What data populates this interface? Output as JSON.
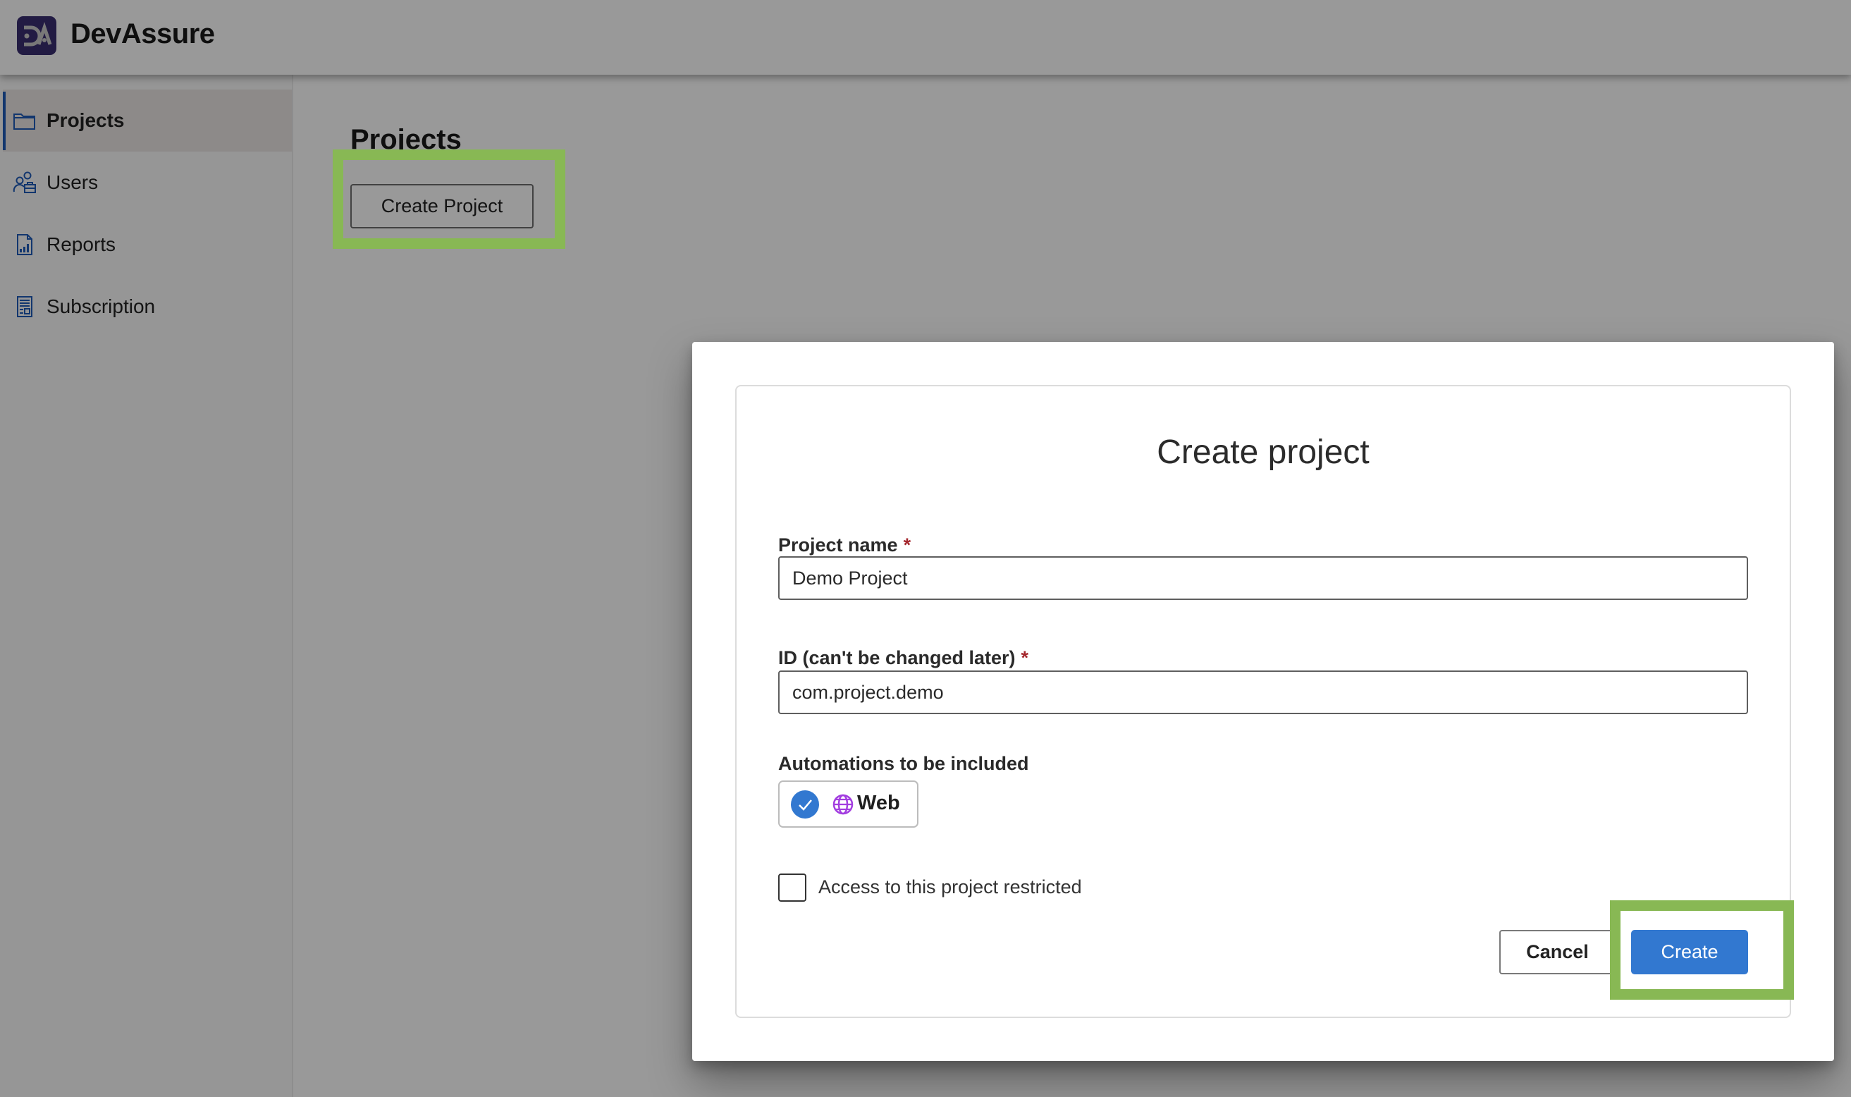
{
  "app": {
    "brand": "DevAssure",
    "logo_text": "DA",
    "brand_color": "#3a2d70",
    "accent_color": "#3278d0",
    "highlight_color": "#88b854"
  },
  "sidebar": {
    "items": [
      {
        "label": "Projects",
        "icon": "folder-icon",
        "active": true
      },
      {
        "label": "Users",
        "icon": "users-icon",
        "active": false
      },
      {
        "label": "Reports",
        "icon": "report-chart-icon",
        "active": false
      },
      {
        "label": "Subscription",
        "icon": "subscription-document-icon",
        "active": false
      }
    ]
  },
  "main": {
    "title": "Projects",
    "create_project_label": "Create Project"
  },
  "modal": {
    "title": "Create project",
    "fields": {
      "project_name": {
        "label": "Project name",
        "required_mark": "*",
        "value": "Demo Project"
      },
      "project_id": {
        "label": "ID (can't be changed later)",
        "required_mark": "*",
        "value": "com.project.demo"
      }
    },
    "automations": {
      "label": "Automations to be included",
      "options": [
        {
          "label": "Web",
          "icon": "globe-icon",
          "selected": true
        }
      ]
    },
    "restricted": {
      "label": "Access to this project restricted",
      "checked": false
    },
    "cancel_label": "Cancel",
    "create_label": "Create"
  }
}
